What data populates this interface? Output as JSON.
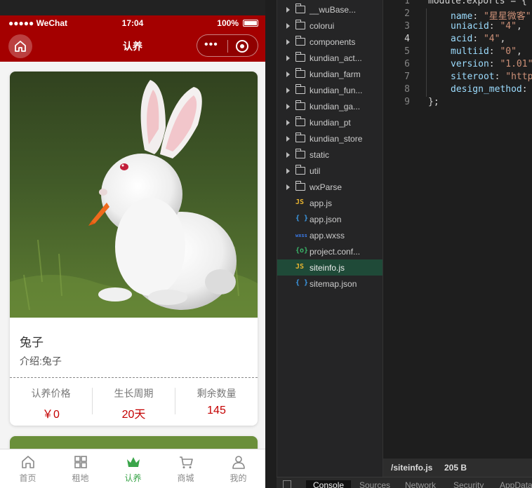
{
  "statusbar": {
    "carrier": "●●●●● WeChat",
    "time": "17:04",
    "battery": "100%"
  },
  "navbar": {
    "title": "认养"
  },
  "product": {
    "name": "兔子",
    "intro": "介绍:兔子",
    "stats": [
      {
        "label": "认养价格",
        "value": "￥0"
      },
      {
        "label": "生长周期",
        "value": "20天"
      },
      {
        "label": "剩余数量",
        "value": "145"
      }
    ]
  },
  "tabbar": [
    {
      "label": "首页",
      "icon": "home-icon"
    },
    {
      "label": "租地",
      "icon": "grid-icon"
    },
    {
      "label": "认养",
      "icon": "crown-icon"
    },
    {
      "label": "商城",
      "icon": "cart-icon"
    },
    {
      "label": "我的",
      "icon": "user-icon"
    }
  ],
  "tree": [
    {
      "name": "__wuBase...",
      "type": "folder"
    },
    {
      "name": "colorui",
      "type": "folder"
    },
    {
      "name": "components",
      "type": "folder"
    },
    {
      "name": "kundian_act...",
      "type": "folder"
    },
    {
      "name": "kundian_farm",
      "type": "folder"
    },
    {
      "name": "kundian_fun...",
      "type": "folder"
    },
    {
      "name": "kundian_ga...",
      "type": "folder"
    },
    {
      "name": "kundian_pt",
      "type": "folder"
    },
    {
      "name": "kundian_store",
      "type": "folder"
    },
    {
      "name": "static",
      "type": "folder"
    },
    {
      "name": "util",
      "type": "folder"
    },
    {
      "name": "wxParse",
      "type": "folder"
    },
    {
      "name": "app.js",
      "type": "js",
      "badge": "JS",
      "color": "#e8b430"
    },
    {
      "name": "app.json",
      "type": "json",
      "badge": "{ }",
      "color": "#3c9be8"
    },
    {
      "name": "app.wxss",
      "type": "wxss",
      "badge": "wxss",
      "color": "#3c7be8"
    },
    {
      "name": "project.conf...",
      "type": "config",
      "badge": "{o}",
      "color": "#3ab56a"
    },
    {
      "name": "siteinfo.js",
      "type": "js",
      "badge": "JS",
      "color": "#e8b430",
      "selected": true
    },
    {
      "name": "sitemap.json",
      "type": "json",
      "badge": "{ }",
      "color": "#3c9be8"
    }
  ],
  "code": {
    "line_numbers": [
      "1",
      "2",
      "3",
      "4",
      "5",
      "6",
      "7",
      "8",
      "9"
    ],
    "current_line": "4",
    "lines": [
      [
        [
          "module.exports = {",
          "p"
        ]
      ],
      [
        [
          "name",
          "k"
        ],
        [
          ": ",
          "p"
        ],
        [
          "\"星星微客\"",
          "s"
        ]
      ],
      [
        [
          "uniacid",
          "k"
        ],
        [
          ": ",
          "p"
        ],
        [
          "\"4\"",
          "s"
        ],
        [
          ",",
          "p"
        ]
      ],
      [
        [
          "acid",
          "k"
        ],
        [
          ": ",
          "p"
        ],
        [
          "\"4\"",
          "s"
        ],
        [
          ",",
          "p"
        ]
      ],
      [
        [
          "multiid",
          "k"
        ],
        [
          ": ",
          "p"
        ],
        [
          "\"0\"",
          "s"
        ],
        [
          ",",
          "p"
        ]
      ],
      [
        [
          "version",
          "k"
        ],
        [
          ": ",
          "p"
        ],
        [
          "\"1.01\"",
          "s"
        ],
        [
          ",",
          "p"
        ]
      ],
      [
        [
          "siteroot",
          "k"
        ],
        [
          ": ",
          "p"
        ],
        [
          "\"https:",
          "s"
        ]
      ],
      [
        [
          "design_method",
          "k"
        ],
        [
          ": ",
          "p"
        ],
        [
          "\"",
          "s"
        ]
      ],
      [
        [
          "};",
          "p"
        ]
      ]
    ]
  },
  "filebar": {
    "path": "/siteinfo.js",
    "size": "205 B"
  },
  "bottom_tabs": [
    "Console",
    "Sources",
    "Network",
    "Security",
    "AppData"
  ],
  "colors": {
    "brand_red": "#a40000",
    "price_red": "#c40000",
    "tab_active_green": "#3aa54a",
    "selected_row": "#1f4a38"
  }
}
